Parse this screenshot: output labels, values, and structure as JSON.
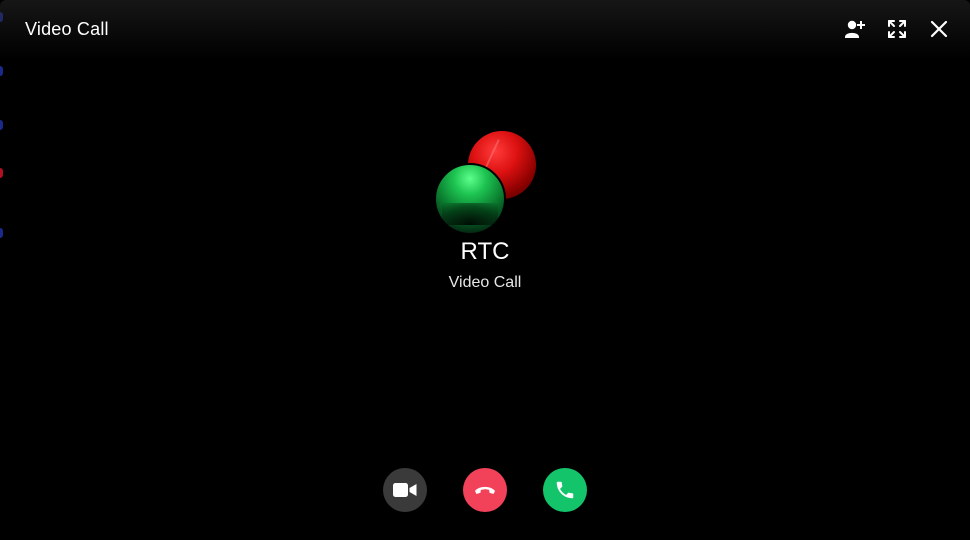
{
  "window": {
    "title": "Video Call"
  },
  "header_actions": {
    "add_user_icon": "add-user-icon",
    "fullscreen_icon": "fullscreen-icon",
    "close_icon": "close-icon"
  },
  "caller": {
    "name": "RTC",
    "status": "Video Call"
  },
  "controls": {
    "camera_icon": "video-camera-icon",
    "decline_icon": "phone-hangup-icon",
    "accept_icon": "phone-accept-icon"
  },
  "colors": {
    "background": "#000000",
    "decline": "#f2425a",
    "accept": "#14c46a",
    "camera_button": "#3a3a3a"
  }
}
